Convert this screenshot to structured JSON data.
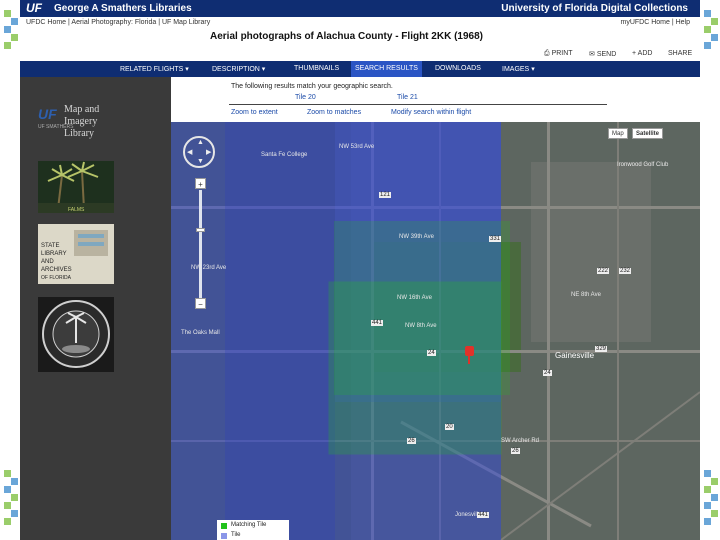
{
  "header": {
    "uf_logo": "UF",
    "library_name": "George A Smathers Libraries",
    "site_name": "University of Florida Digital Collections"
  },
  "breadcrumb": {
    "items": [
      "UFDC Home",
      "Aerial Photography: Florida",
      "UF Map Library"
    ],
    "right_links": [
      "myUFDC Home",
      "Help"
    ]
  },
  "page_title": "Aerial photographs of Alachua County - Flight 2KK (1968)",
  "actions": [
    "PRINT",
    "SEND",
    "ADD",
    "SHARE"
  ],
  "nav_tabs": [
    {
      "label": "RELATED FLIGHTS",
      "dropdown": true,
      "active": false
    },
    {
      "label": "DESCRIPTION",
      "dropdown": true,
      "active": false
    },
    {
      "label": "THUMBNAILS",
      "dropdown": false,
      "active": false
    },
    {
      "label": "SEARCH RESULTS",
      "dropdown": false,
      "active": true
    },
    {
      "label": "DOWNLOADS",
      "dropdown": false,
      "active": false
    },
    {
      "label": "IMAGES",
      "dropdown": true,
      "active": false
    }
  ],
  "sidebar": {
    "logo_uf": "UF",
    "logo_small": "UF SMATHERS",
    "logo_lines": [
      "Map and",
      "Imagery",
      "Library"
    ],
    "thumb1_caption": "FALMS",
    "thumb2_lines": [
      "STATE",
      "LIBRARY",
      "AND",
      "ARCHIVES",
      "OF FLORIDA"
    ]
  },
  "results": {
    "intro": "The following results match your geographic search.",
    "tiles": [
      "Tile 20",
      "Tile 21"
    ],
    "links": [
      "Zoom to extent",
      "Zoom to matches",
      "Modify search within flight"
    ]
  },
  "map": {
    "type_buttons": [
      "Map",
      "Satellite"
    ],
    "labels": [
      "NW 53rd Ave",
      "NW 39th Ave",
      "NW 16th Ave",
      "NW 8th Ave",
      "Gainesville",
      "The Oaks Mall",
      "Jonesville",
      "Santa Fe College",
      "NW 23rd Ave",
      "NE 8th Ave",
      "SW Archer Rd",
      "Ironwood Golf Club"
    ],
    "shields": [
      "121",
      "441",
      "24",
      "26",
      "331",
      "329",
      "20",
      "222",
      "232",
      "26",
      "24",
      "441"
    ],
    "legend": [
      "Matching Tile",
      "Tile"
    ]
  },
  "colors": {
    "brand_blue": "#0f2d72",
    "active_tab": "#2b55c4",
    "overlay_blue": "#3b4fd6",
    "match_green": "#22c21c",
    "marker_red": "#e0322a"
  }
}
